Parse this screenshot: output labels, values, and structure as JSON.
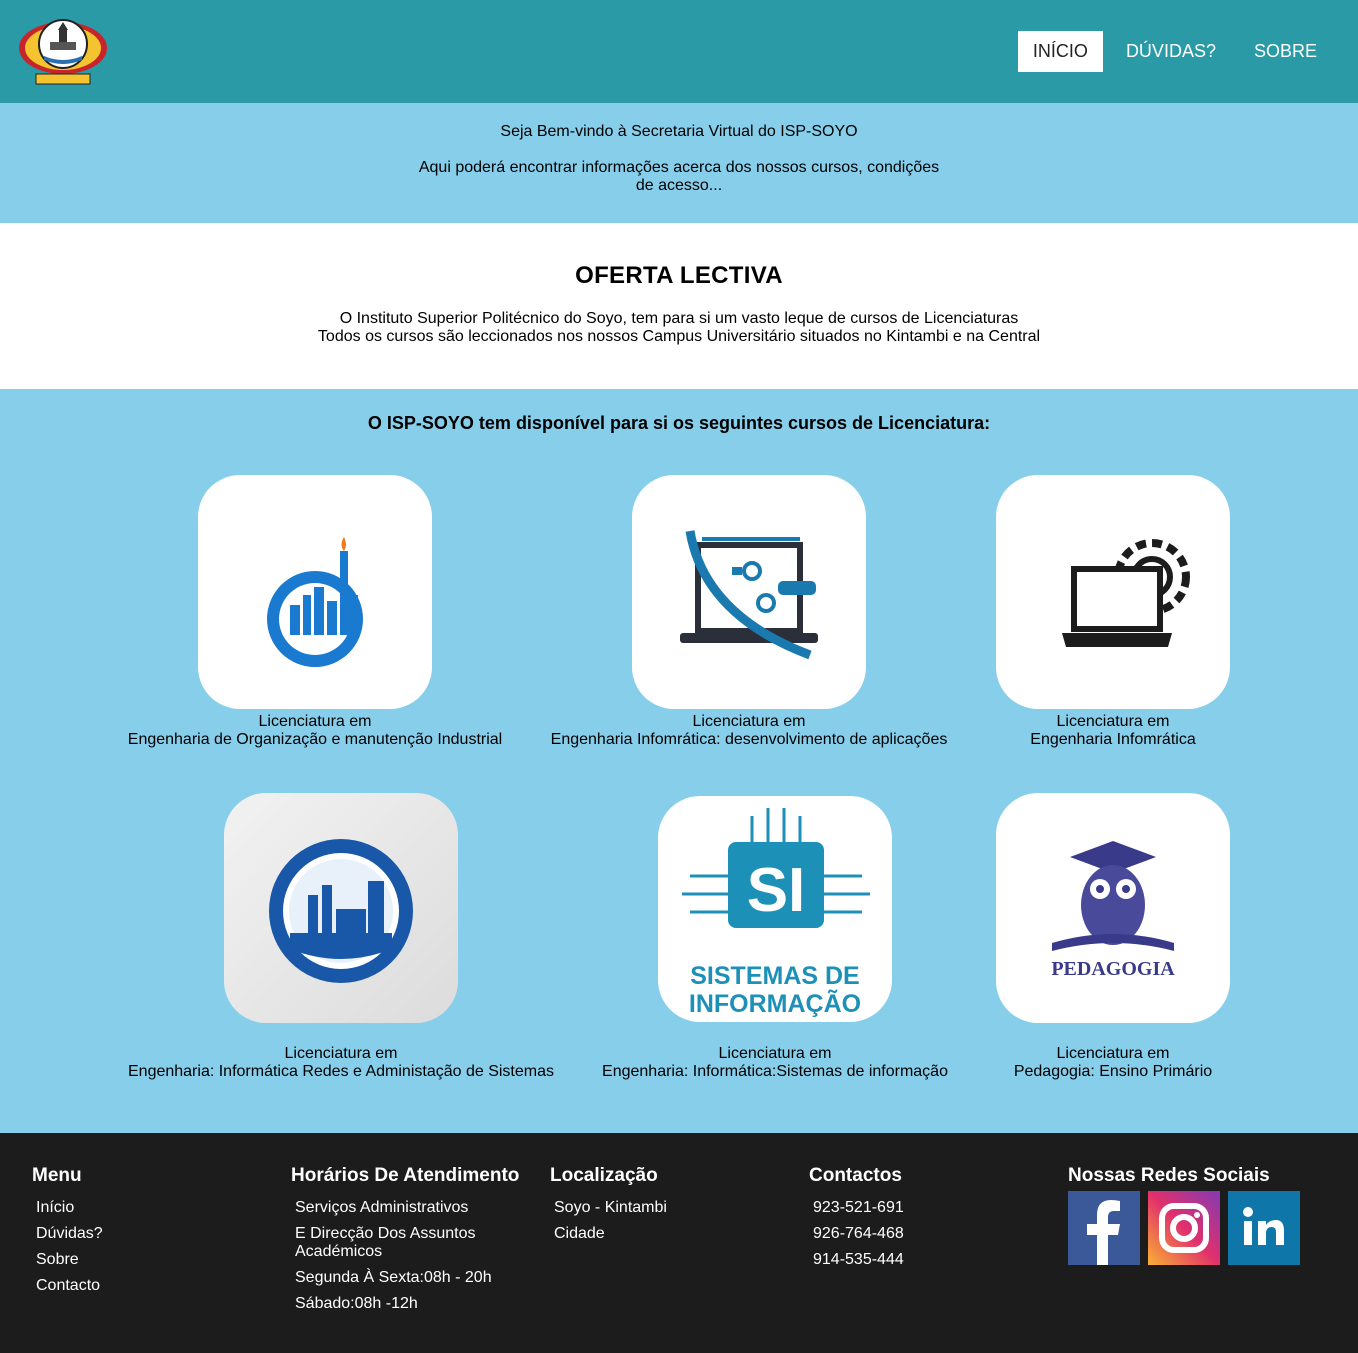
{
  "nav": {
    "items": [
      {
        "label": "INÍCIO",
        "active": true
      },
      {
        "label": "DÚVIDAS?"
      },
      {
        "label": "SOBRE"
      }
    ]
  },
  "welcome": {
    "line1": "Seja Bem-vindo à Secretaria Virtual do ISP-SOYO",
    "line2": "Aqui poderá encontrar informações acerca dos nossos cursos, condições de acesso..."
  },
  "offer": {
    "title": "OFERTA LECTIVA",
    "line1": "O Instituto Superior Politécnico do Soyo, tem para si um vasto leque de cursos de Licenciaturas",
    "line2": "Todos os cursos são leccionados nos nossos Campus Universitário situados no Kintambi e na Central"
  },
  "courses": {
    "heading": "O ISP-SOYO tem disponível para si os seguintes cursos de Licenciatura:",
    "items": [
      {
        "prefix": "Licenciatura em",
        "name": "Engenharia de Organização e manutenção Industrial",
        "icon": "industrial-gear-icon"
      },
      {
        "prefix": "Licenciatura em",
        "name": "Engenharia Infomrática: desenvolvimento de aplicações",
        "icon": "laptop-tools-icon"
      },
      {
        "prefix": "Licenciatura em",
        "name": "Engenharia Infomrática",
        "icon": "laptop-gear-icon"
      },
      {
        "prefix": "Licenciatura em",
        "name": "Engenharia: Informática Redes e Administação de Sistemas",
        "icon": "factory-gear-icon"
      },
      {
        "prefix": "Licenciatura em",
        "name": "Engenharia: Informática:Sistemas de informação",
        "icon": "si-chip-icon",
        "logo_text": {
          "big": "SI",
          "line1": "SISTEMAS DE",
          "line2": "INFORMAÇÃO"
        }
      },
      {
        "prefix": "Licenciatura em",
        "name": "Pedagogia: Ensino Primário",
        "icon": "owl-graduate-icon",
        "logo_text": {
          "big": "PEDAGOGIA"
        }
      }
    ]
  },
  "footer": {
    "menu": {
      "title": "Menu",
      "items": [
        "Início",
        "Dúvidas?",
        "Sobre",
        "Contacto"
      ]
    },
    "hours": {
      "title": "Horários De Atendimento",
      "items": [
        "Serviços Administrativos",
        "E Direcção Dos Assuntos Académicos",
        "Segunda À Sexta:08h - 20h",
        "Sábado:08h -12h"
      ]
    },
    "location": {
      "title": "Localização",
      "items": [
        "Soyo - Kintambi",
        "Cidade"
      ]
    },
    "contacts": {
      "title": "Contactos",
      "items": [
        "923-521-691",
        "926-764-468",
        "914-535-444"
      ]
    },
    "social": {
      "title": "Nossas Redes Sociais",
      "items": [
        "facebook-icon",
        "instagram-icon",
        "linkedin-icon"
      ]
    }
  },
  "colors": {
    "header": "#2a9aa6",
    "light": "#87ceeb",
    "footer": "#1c1c1c",
    "blue": "#1a7ad0"
  }
}
